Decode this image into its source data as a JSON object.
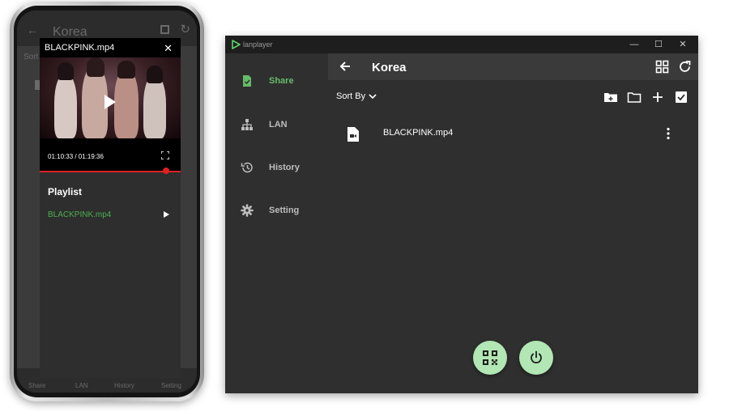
{
  "phone": {
    "bg": {
      "back": "←",
      "title": "Korea",
      "refresh": "↻",
      "sort": "Sort",
      "nav": [
        "Share",
        "LAN",
        "History",
        "Setting"
      ]
    },
    "player": {
      "title": "BLACKPINK.mp4",
      "close": "✕",
      "time": "01:10:33 / 01:19:36",
      "progress": 0.89,
      "icons": [
        "play-icon",
        "fullscreen-icon",
        "close-icon"
      ]
    },
    "playlist": {
      "title": "Playlist",
      "items": [
        {
          "label": "BLACKPINK.mp4",
          "active": true
        }
      ]
    }
  },
  "window": {
    "app_name": "lanplayer",
    "controls": {
      "minimize": "—",
      "maximize": "☐",
      "close": "✕"
    },
    "sidebar": {
      "items": [
        {
          "label": "Share",
          "icon": "share-file-icon",
          "active": true
        },
        {
          "label": "LAN",
          "icon": "lan-icon",
          "active": false
        },
        {
          "label": "History",
          "icon": "history-icon",
          "active": false
        },
        {
          "label": "Setting",
          "icon": "gear-icon",
          "active": false
        }
      ]
    },
    "header": {
      "title": "Korea",
      "icons": [
        "back-arrow-icon",
        "grid-view-icon",
        "refresh-icon"
      ]
    },
    "toolbar": {
      "sort_label": "Sort By",
      "icons": [
        "new-folder-icon",
        "folder-icon",
        "add-icon",
        "select-all-icon"
      ]
    },
    "files": [
      {
        "name": "BLACKPINK.mp4",
        "icon": "video-file-icon"
      }
    ],
    "fabs": [
      "qr-code-icon",
      "power-icon"
    ]
  },
  "colors": {
    "accent": "#66bb6a",
    "playlist_active": "#4caf50",
    "fab": "#b2e6b4",
    "seek": "#dd2222"
  }
}
